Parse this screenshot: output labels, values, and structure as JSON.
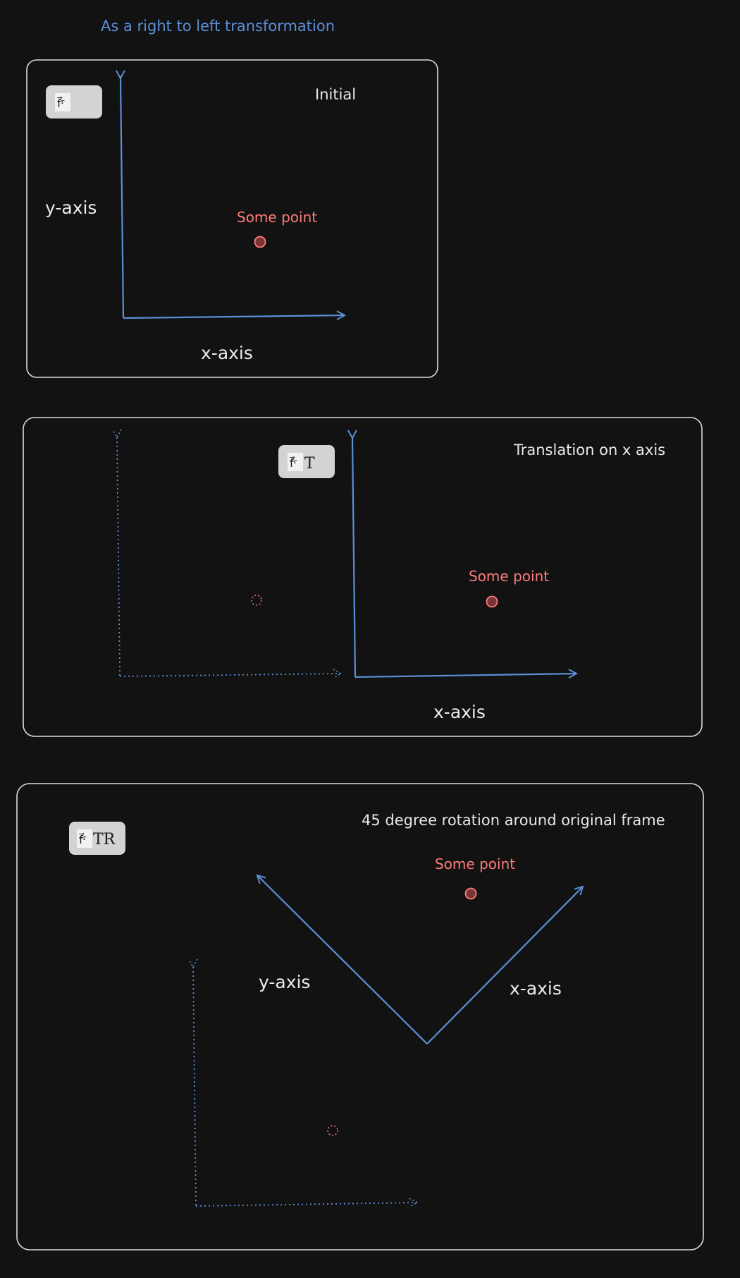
{
  "heading": "As a right to left transformation",
  "colors": {
    "background": "#121212",
    "frame": "#dcdcdc",
    "axis": "#5b8fd6",
    "point": "#ff7b7b",
    "point_fill": "#7a3434",
    "badge": "#d3d3d3",
    "text": "#ececec"
  },
  "panels": [
    {
      "title": "Initial",
      "badge": {
        "glyph": "f⃗ʳ",
        "suffix": ""
      },
      "y_label": "y-axis",
      "x_label": "x-axis",
      "point_label": "Some point"
    },
    {
      "title": "Translation on x axis",
      "badge": {
        "glyph": "f⃗ʳ",
        "suffix": "T"
      },
      "x_label": "x-axis",
      "point_label": "Some point"
    },
    {
      "title": "45 degree rotation around original frame",
      "badge": {
        "glyph": "f⃗ʳ",
        "suffix": "TR"
      },
      "y_label": "y-axis",
      "x_label": "x-axis",
      "point_label": "Some point"
    }
  ]
}
